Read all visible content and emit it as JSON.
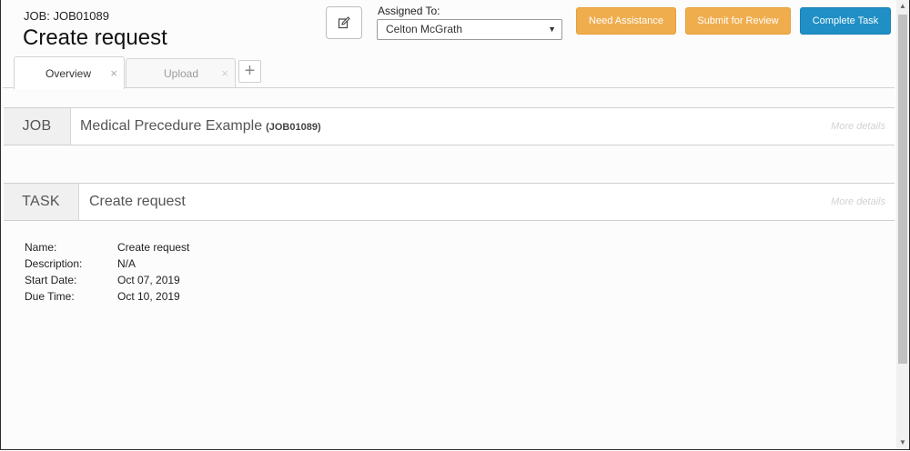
{
  "header": {
    "job_code": "JOB: JOB01089",
    "title": "Create request",
    "assigned_label": "Assigned To:",
    "assigned_value": "Celton McGrath",
    "buttons": {
      "need_assistance": "Need Assistance",
      "submit_review": "Submit for Review",
      "complete_task": "Complete Task"
    }
  },
  "tabs": [
    {
      "label": "Overview",
      "close": "×"
    },
    {
      "label": "Upload",
      "close": "×"
    }
  ],
  "tab_add": "+",
  "job_section": {
    "tag": "JOB",
    "title": "Medical Precedure Example",
    "code": "(JOB01089)",
    "more": "More details"
  },
  "task_section": {
    "tag": "TASK",
    "title": "Create request",
    "more": "More details"
  },
  "details": [
    {
      "label": "Name:",
      "value": "Create request"
    },
    {
      "label": "Description:",
      "value": "N/A"
    },
    {
      "label": "Start Date:",
      "value": "Oct 07, 2019"
    },
    {
      "label": "Due Time:",
      "value": "Oct 10, 2019"
    }
  ],
  "icons": {
    "edit": "edit-icon",
    "dropdown": "chevron-down-icon"
  },
  "colors": {
    "orange": "#f0ad4e",
    "blue": "#1f8fc6"
  }
}
